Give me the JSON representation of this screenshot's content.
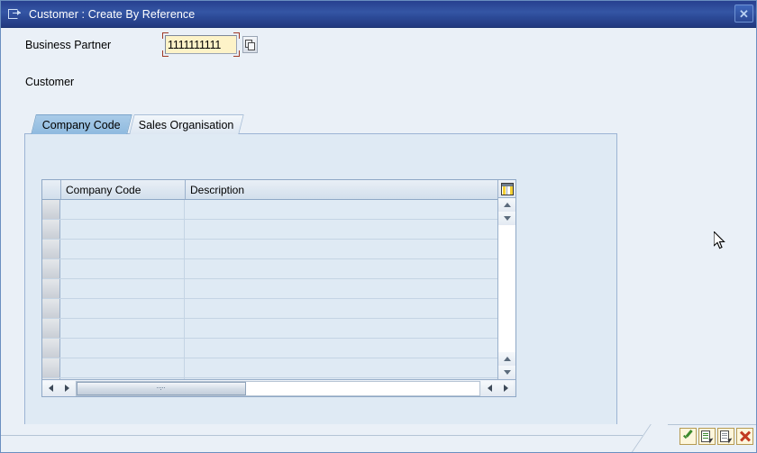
{
  "window": {
    "title": "Customer : Create By Reference",
    "icon": "session-export-icon",
    "close_label": "✕",
    "close_name": "close-window-button"
  },
  "form": {
    "business_partner": {
      "label": "Business Partner",
      "value": "1111111111",
      "placeholder": "",
      "multi_select_title": "Multiple selection"
    },
    "section_title": "Customer"
  },
  "tabs": [
    {
      "label": "Company Code",
      "active": true
    },
    {
      "label": "Sales Organisation",
      "active": false
    }
  ],
  "table": {
    "settings_icon": "table-settings-icon",
    "columns": [
      {
        "label": "Company Code"
      },
      {
        "label": "Description"
      }
    ],
    "rows": [
      {
        "company_code": "",
        "description": ""
      },
      {
        "company_code": "",
        "description": ""
      },
      {
        "company_code": "",
        "description": ""
      },
      {
        "company_code": "",
        "description": ""
      },
      {
        "company_code": "",
        "description": ""
      },
      {
        "company_code": "",
        "description": ""
      },
      {
        "company_code": "",
        "description": ""
      },
      {
        "company_code": "",
        "description": ""
      },
      {
        "company_code": "",
        "description": ""
      },
      {
        "company_code": "",
        "description": ""
      }
    ],
    "scroll": {
      "up_glyph": "scroll-up-icon",
      "down_glyph": "scroll-down-icon",
      "left_glyph": "scroll-left-icon",
      "right_glyph": "scroll-right-icon"
    }
  },
  "toolbar": {
    "buttons": [
      {
        "name": "continue-button",
        "icon": "green-check-icon",
        "state": "enabled"
      },
      {
        "name": "copy-reference-button",
        "icon": "document-cursor-green-icon",
        "state": "enabled"
      },
      {
        "name": "select-reference-button",
        "icon": "document-cursor-gray-icon",
        "state": "disabled"
      },
      {
        "name": "cancel-button",
        "icon": "red-x-icon",
        "state": "enabled"
      }
    ]
  },
  "colors": {
    "titlebar": "#2c4a97",
    "input_required": "#fdf3c8",
    "focus_bracket": "#a03a26",
    "tab_active": "#8fbadf",
    "panel": "#dfeaf4",
    "background": "#eaf0f7"
  }
}
